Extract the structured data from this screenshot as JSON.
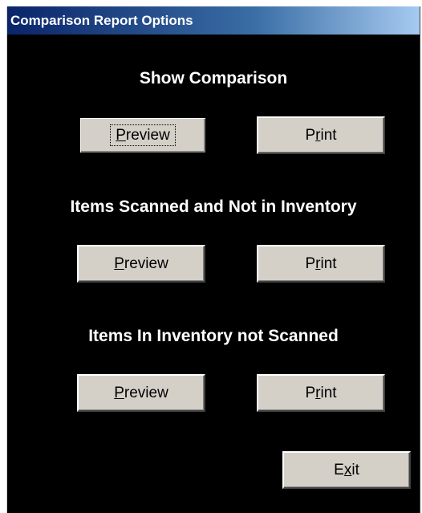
{
  "window": {
    "title": "Comparison Report Options"
  },
  "sections": [
    {
      "heading": "Show Comparison",
      "preview": {
        "pre": "",
        "mn": "P",
        "post": "review"
      },
      "print": {
        "pre": "P",
        "mn": "r",
        "post": "int"
      }
    },
    {
      "heading": "Items Scanned and Not in Inventory",
      "preview": {
        "pre": "",
        "mn": "P",
        "post": "review"
      },
      "print": {
        "pre": "P",
        "mn": "r",
        "post": "int"
      }
    },
    {
      "heading": "Items In Inventory not Scanned",
      "preview": {
        "pre": "",
        "mn": "P",
        "post": "review"
      },
      "print": {
        "pre": "P",
        "mn": "r",
        "post": "int"
      }
    }
  ],
  "exit": {
    "pre": "E",
    "mn": "x",
    "post": "it"
  },
  "colors": {
    "background": "#000000",
    "button_face": "#d4d0c8",
    "title_start": "#0a246a",
    "title_end": "#a6caf0"
  }
}
